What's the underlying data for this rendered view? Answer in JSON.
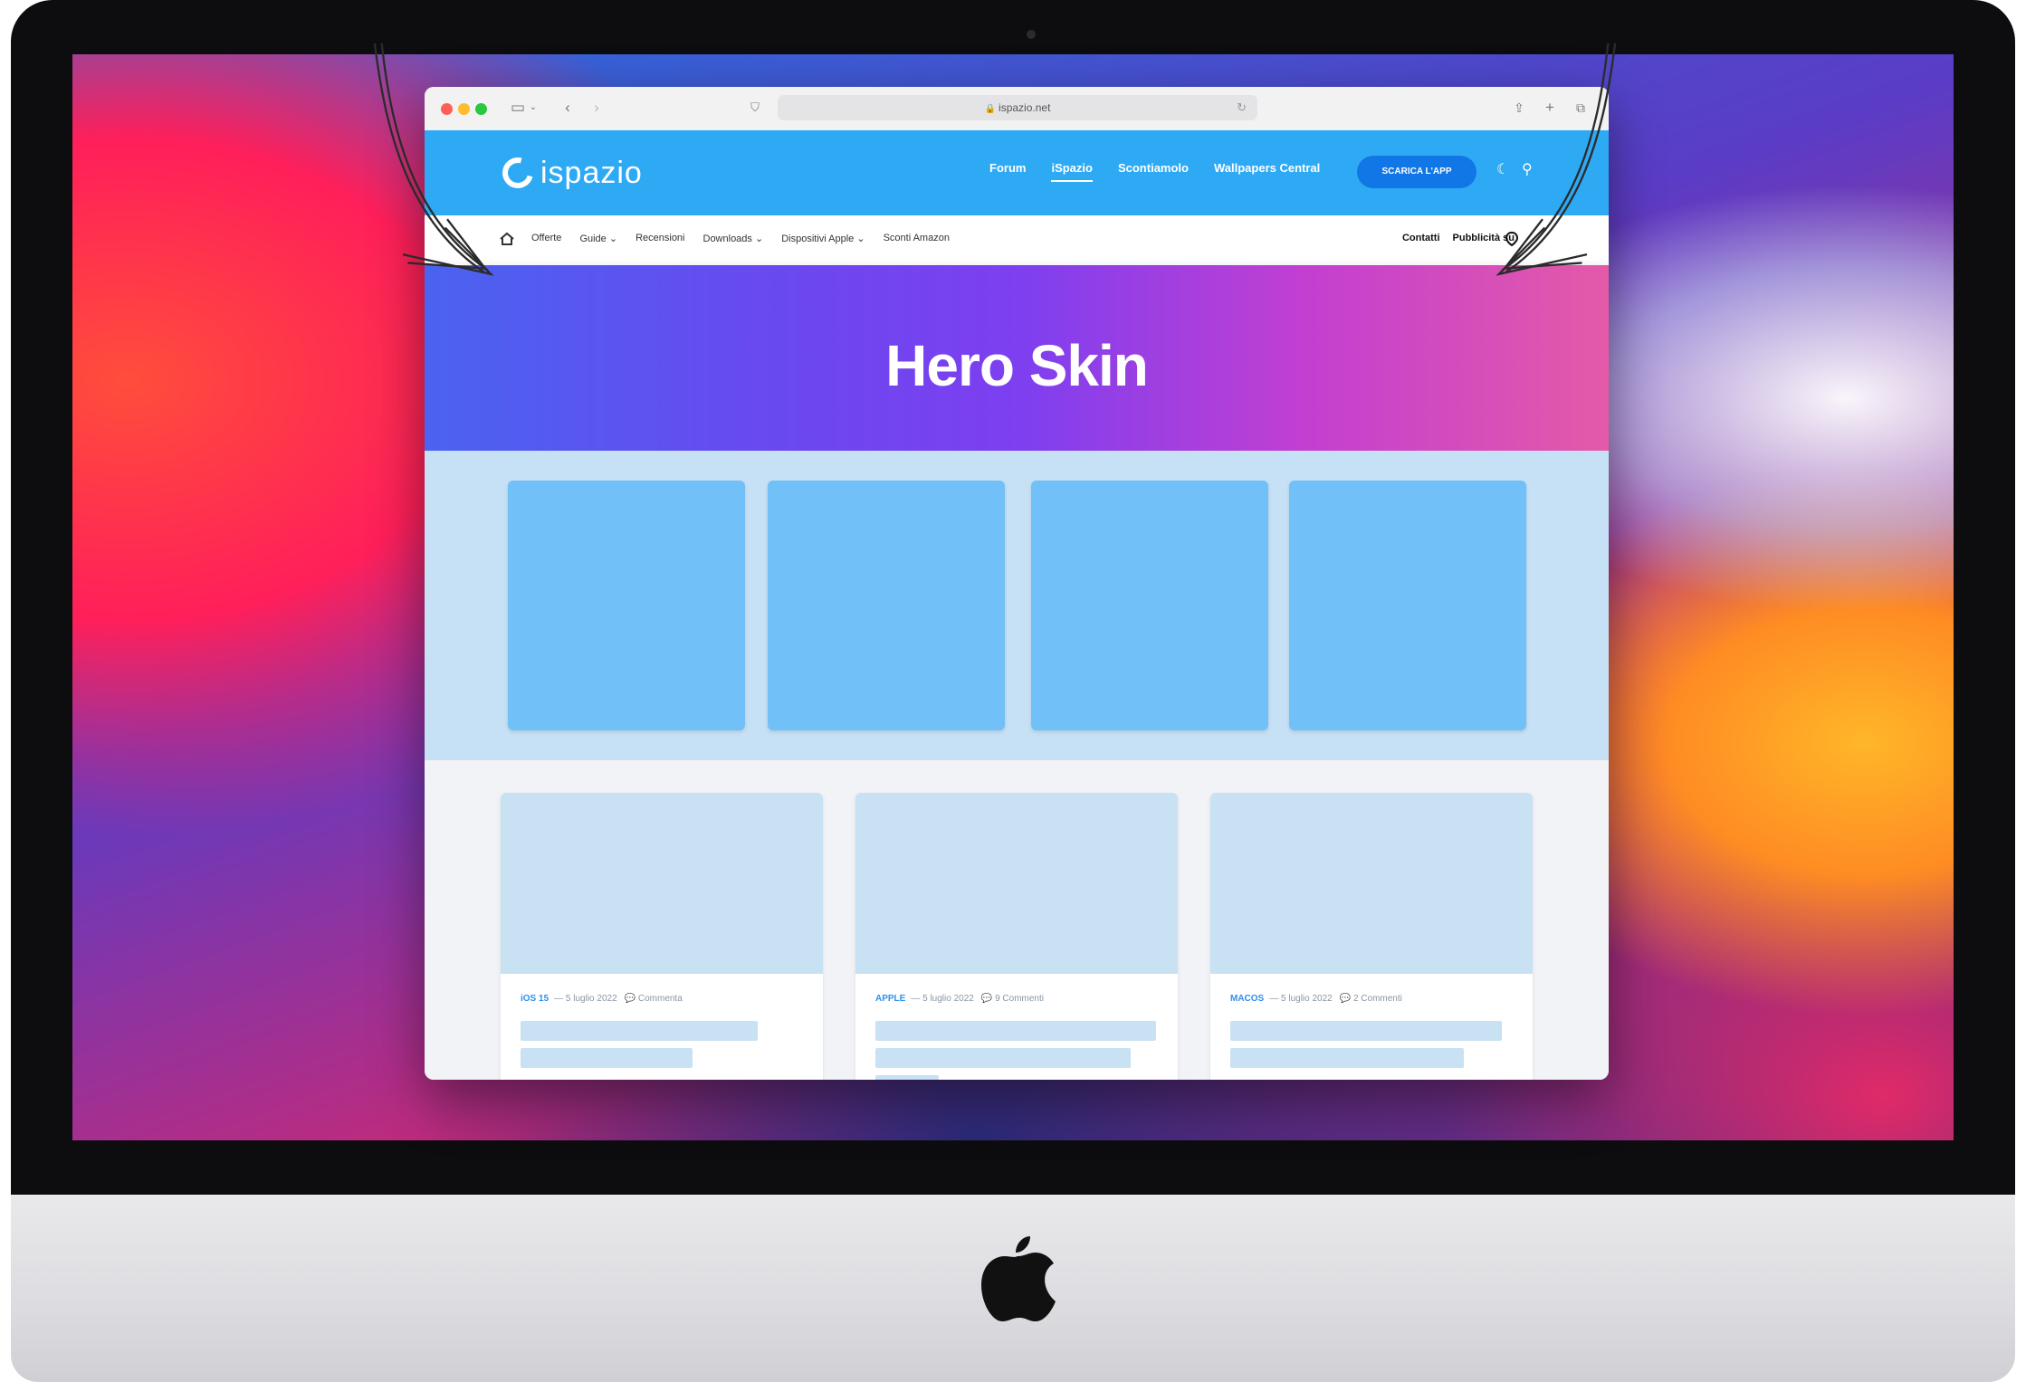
{
  "browser": {
    "url": "ispazio.net"
  },
  "site": {
    "logo_text": "ispazio",
    "nav": [
      "Forum",
      "iSpazio",
      "Scontiamolo",
      "Wallpapers Central"
    ],
    "cta_label": "SCARICA L'APP",
    "subnav_left": [
      "Offerte",
      "Guide ⌄",
      "Recensioni",
      "Downloads ⌄",
      "Dispositivi Apple ⌄",
      "Sconti Amazon"
    ],
    "subnav_right": [
      "Contatti",
      "Pubblicità su"
    ]
  },
  "hero": {
    "title": "Hero Skin"
  },
  "articles": [
    {
      "category": "iOS 15",
      "date": "— 5 luglio 2022",
      "comments": "💬 Commenta"
    },
    {
      "category": "APPLE",
      "date": "— 5 luglio 2022",
      "comments": "💬 9 Commenti"
    },
    {
      "category": "MACOS",
      "date": "— 5 luglio 2022",
      "comments": "💬 2 Commenti"
    }
  ],
  "colors": {
    "header_blue": "#2eaaf5",
    "cta_blue": "#1277e6",
    "tile_blue": "#71c0f8",
    "band_bg": "#c6e1f5"
  },
  "icons": [
    "apple-logo-icon",
    "sidebar-icon",
    "back-icon",
    "forward-icon",
    "shield-icon",
    "share-icon",
    "new-tab-icon",
    "tabs-icon",
    "theme-toggle-icon",
    "search-icon",
    "home-icon",
    "location-icon"
  ]
}
